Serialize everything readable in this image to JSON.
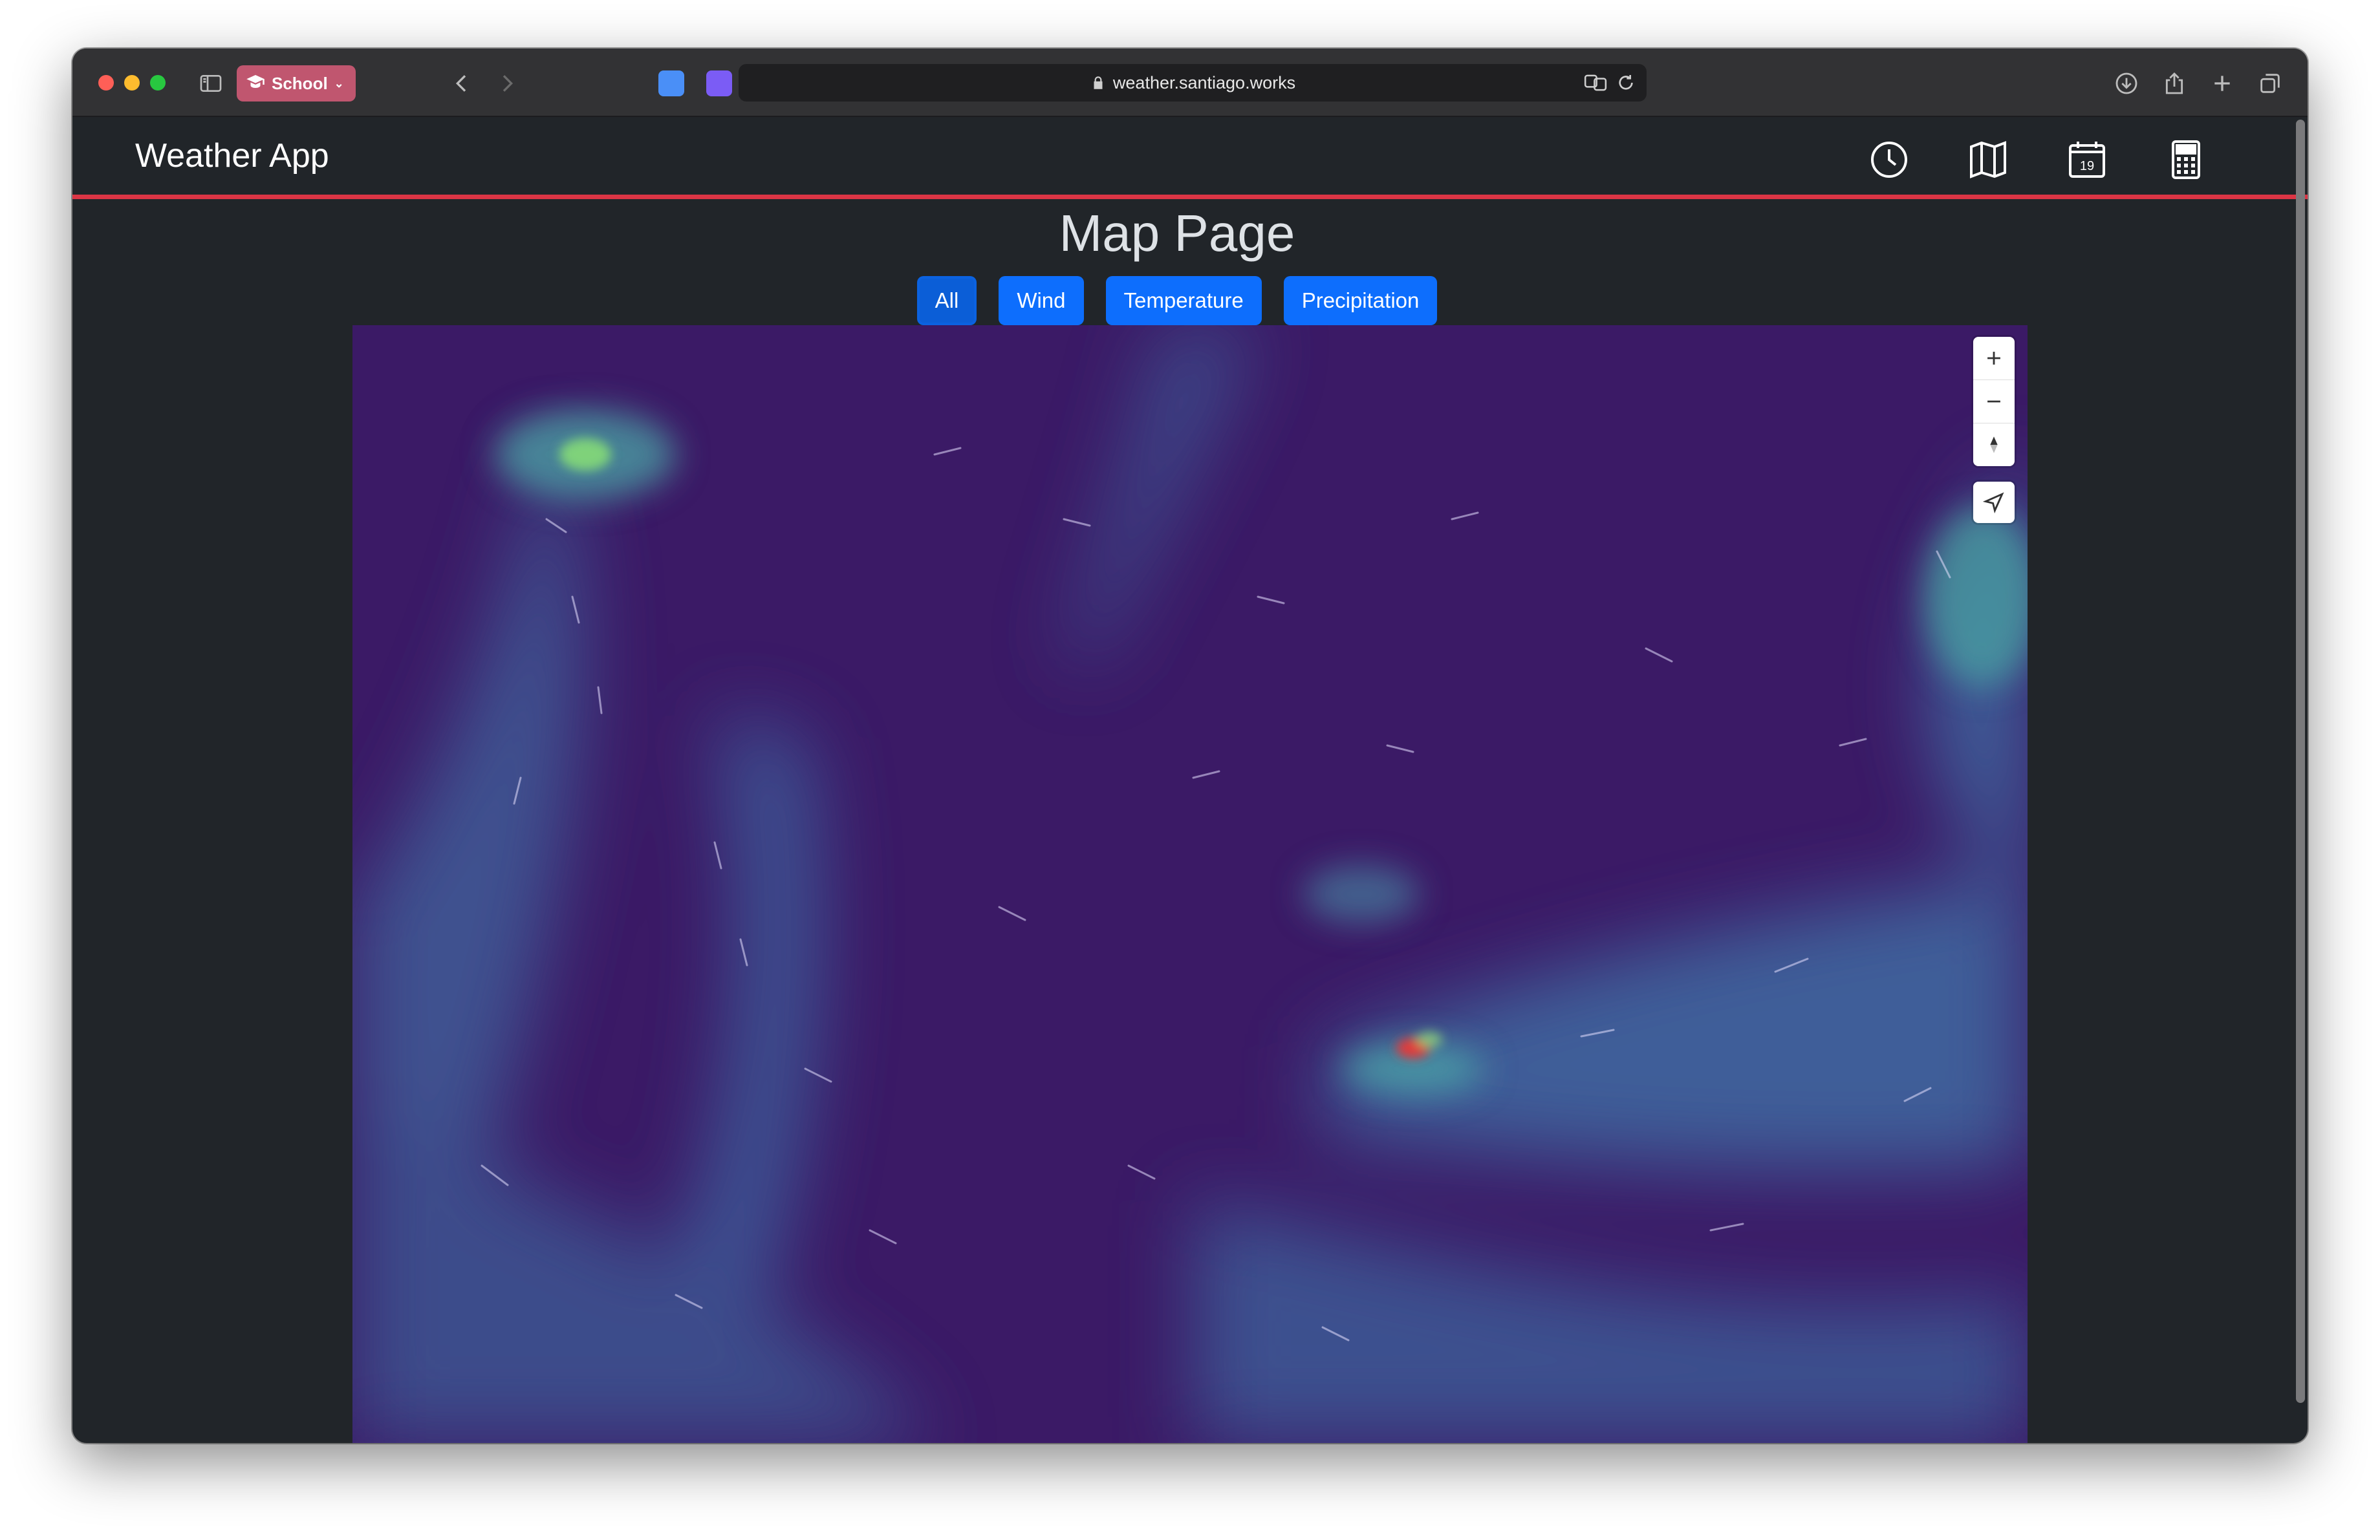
{
  "browser": {
    "profile_label": "School",
    "url": "weather.santiago.works"
  },
  "navbar": {
    "brand": "Weather App",
    "icons": [
      "clock-icon",
      "map-icon",
      "calendar-icon",
      "calculator-icon"
    ],
    "calendar_day": "19",
    "accent_color": "#dc3545"
  },
  "page": {
    "title": "Map Page",
    "filters": [
      {
        "label": "All",
        "active": true
      },
      {
        "label": "Wind"
      },
      {
        "label": "Temperature"
      },
      {
        "label": "Precipitation"
      }
    ]
  },
  "map": {
    "controls": [
      "zoom-in-icon",
      "zoom-out-icon",
      "compass-icon",
      "geolocate-icon"
    ],
    "palette": {
      "low": "#3b1a66",
      "mid": "#3d6ea0",
      "high": "#4cc9a0",
      "peak": "#e23a3a"
    }
  }
}
